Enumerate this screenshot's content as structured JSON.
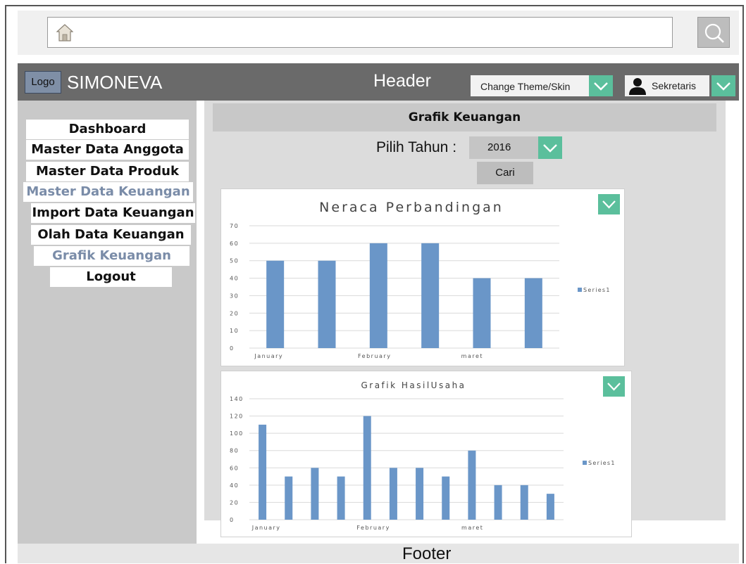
{
  "header": {
    "logo": "Logo",
    "app_name": "SIMONEVA",
    "title": "Header",
    "theme_label": "Change Theme/Skin",
    "user_label": "Sekretaris"
  },
  "icons": {
    "home": "home-icon",
    "search": "search-icon",
    "user": "user-icon",
    "dropdown": "chevron-down-icon"
  },
  "colors": {
    "accent": "#5bbf9c",
    "header": "#6a6a6a",
    "sidebar": "#c9c9c9",
    "bar": "#6a96c8",
    "active_nav": "#7a8ca8"
  },
  "sidebar": {
    "items": [
      {
        "label": "Dashboard"
      },
      {
        "label": "Master Data Anggota"
      },
      {
        "label": "Master Data Produk"
      },
      {
        "label": "Master Data Keuangan"
      },
      {
        "label": "Import Data Keuangan"
      },
      {
        "label": "Olah Data Keuangan"
      },
      {
        "label": "Grafik Keuangan"
      },
      {
        "label": "Logout"
      }
    ]
  },
  "main": {
    "title": "Grafik Keuangan",
    "year_label": "Pilih Tahun :",
    "year_value": "2016",
    "search_button": "Cari"
  },
  "chart_data": [
    {
      "type": "bar",
      "title": "Neraca Perbandingan",
      "categories": [
        "January",
        "",
        "February",
        "",
        "maret",
        ""
      ],
      "series": [
        {
          "name": "Series1",
          "values": [
            50,
            50,
            60,
            60,
            40,
            40
          ]
        }
      ],
      "ylim": [
        0,
        70
      ],
      "yticks": [
        0,
        10,
        20,
        30,
        40,
        50,
        60,
        70
      ],
      "legend": "right",
      "grid": true
    },
    {
      "type": "bar",
      "title": "Grafik HasilUsaha",
      "categories": [
        "January",
        "",
        "",
        "",
        "February",
        "",
        "",
        "",
        "maret",
        "",
        "",
        ""
      ],
      "series": [
        {
          "name": "Series1",
          "values": [
            110,
            50,
            60,
            50,
            120,
            60,
            60,
            50,
            80,
            40,
            40,
            30
          ]
        }
      ],
      "ylim": [
        0,
        140
      ],
      "yticks": [
        0,
        20,
        40,
        60,
        80,
        100,
        120,
        140
      ],
      "legend": "right",
      "grid": true
    }
  ],
  "footer": {
    "label": "Footer"
  }
}
